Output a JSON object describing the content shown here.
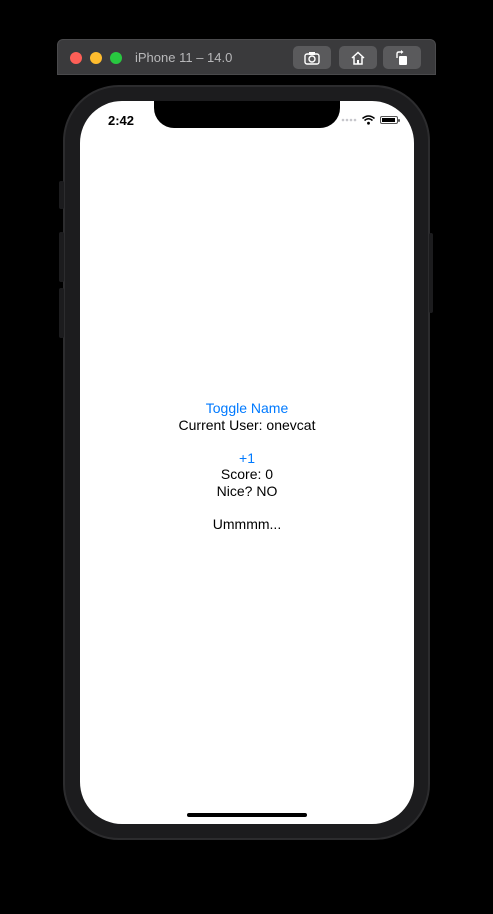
{
  "simulator": {
    "title": "iPhone 11 – 14.0",
    "toolbar": {
      "screenshot_icon": "camera-icon",
      "home_icon": "home-icon",
      "rotate_icon": "rotate-icon"
    }
  },
  "status_bar": {
    "time": "2:42",
    "icons": [
      "cellular-dots-icon",
      "wifi-icon",
      "battery-icon"
    ]
  },
  "app": {
    "toggle_name_label": "Toggle Name",
    "current_user_text": "Current User: onevcat",
    "increment_label": "+1",
    "score_text": "Score: 0",
    "nice_text": "Nice? NO",
    "footer_text": "Ummmm...",
    "accent_color": "#007aff"
  }
}
